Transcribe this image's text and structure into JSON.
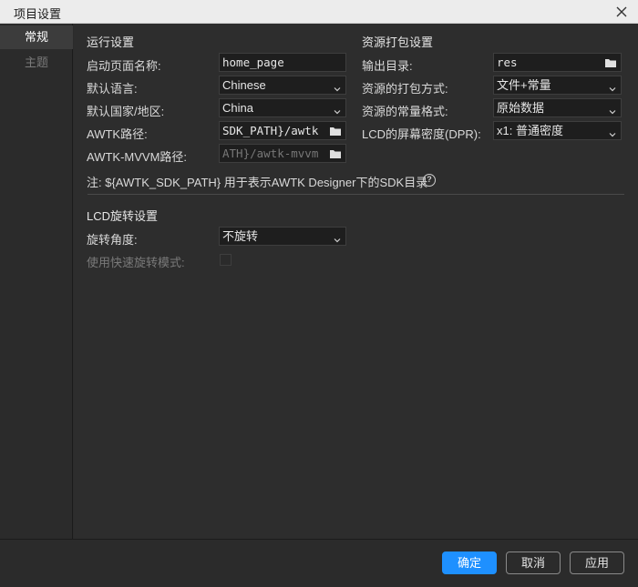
{
  "window": {
    "title": "项目设置"
  },
  "sidebar": {
    "tabs": [
      {
        "label": "常规",
        "active": true
      },
      {
        "label": "主题",
        "active": false
      }
    ]
  },
  "run": {
    "section_title": "运行设置",
    "start_page": {
      "label": "启动页面名称:",
      "value": "home_page"
    },
    "language": {
      "label": "默认语言:",
      "value": "Chinese"
    },
    "country": {
      "label": "默认国家/地区:",
      "value": "China"
    },
    "awtk_path": {
      "label": "AWTK路径:",
      "value": "SDK_PATH}/awtk"
    },
    "mvvm_path": {
      "label": "AWTK-MVVM路径:",
      "value": "ATH}/awtk-mvvm"
    }
  },
  "resource": {
    "section_title": "资源打包设置",
    "output_dir": {
      "label": "输出目录:",
      "value": "res"
    },
    "pack_mode": {
      "label": "资源的打包方式:",
      "value": "文件+常量"
    },
    "const_format": {
      "label": "资源的常量格式:",
      "value": "原始数据"
    },
    "dpr": {
      "label": "LCD的屏幕密度(DPR):",
      "value": "x1: 普通密度"
    }
  },
  "note": {
    "text": "注: ${AWTK_SDK_PATH} 用于表示AWTK  Designer下的SDK目录",
    "help": "?"
  },
  "lcd": {
    "section_title": "LCD旋转设置",
    "rotation": {
      "label": "旋转角度:",
      "value": "不旋转"
    },
    "fast_rotation": {
      "label": "使用快速旋转模式:",
      "checked": false
    }
  },
  "footer": {
    "ok": "确定",
    "cancel": "取消",
    "apply": "应用"
  },
  "colors": {
    "accent": "#1e90ff",
    "background": "#2d2d2d",
    "field_bg": "#1e1e1e"
  },
  "icons": {
    "close": "close-icon",
    "folder": "folder-icon",
    "chevron": "chevron-down-icon",
    "help": "help-icon"
  }
}
